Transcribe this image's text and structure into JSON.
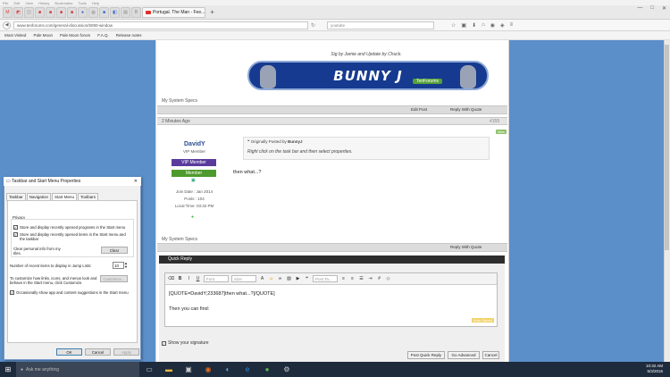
{
  "browser": {
    "menu": [
      "File",
      "Edit",
      "View",
      "History",
      "Bookmarks",
      "Tools",
      "Help"
    ],
    "active_tab_title": "Portugal. The Man - Fee...",
    "new_tab": "+",
    "url": "www.tenforums.com/general-discussion/5090-window",
    "search_placeholder": "youtube",
    "bookmarks": [
      "Most Visited",
      "Pale Moon",
      "Pale Moon forum",
      "F.A.Q.",
      "Release notes"
    ]
  },
  "post_top": {
    "sig_line": "Sig by Jamie and Update by Chuck.",
    "banner_text": "BUNNY J",
    "banner_ribbon": "TenForums",
    "my_system_specs": "My System Specs",
    "edit_post": "Edit Post",
    "reply_with_quote": "Reply With Quote"
  },
  "post": {
    "timestamp": "2 Minutes Ago",
    "post_number": "#155",
    "badge_new": "New",
    "username": "DavidY",
    "user_title": "VIP Member",
    "rank1": "VIP Member",
    "rank2": "Member",
    "join_date": "Join Date : Jan 2014",
    "posts": "Posts : 104",
    "local_time": "Local Time: 03:32 PM",
    "quote_header": "Originally Posted by",
    "quote_author": "BunnyJ",
    "quote_text": "Right click on the task bar and then select properties.",
    "body": "then what...?",
    "my_system_specs": "My System Specs",
    "reply_with_quote": "Reply With Quote"
  },
  "quick_reply": {
    "header": "Quick Reply",
    "font_placeholder": "Font",
    "size_placeholder": "Size",
    "post_tag_placeholder": "Post Ta...",
    "line1": "[QUOTE=DavidY;233687]then what...?[/QUOTE]",
    "line2": "Then you can find:",
    "autosave": "Auto Saved",
    "show_signature": "Show your signature",
    "post_quick_reply": "Post Quick Reply",
    "go_advanced": "Go Advanced",
    "cancel": "Cancel"
  },
  "dialog": {
    "title": "Taskbar and Start Menu Properties",
    "tabs": [
      "Taskbar",
      "Navigation",
      "Start Menu",
      "Toolbars"
    ],
    "privacy": "Privacy",
    "opt1": "Store and display recently opened programs in the Start menu",
    "opt2": "Store and display recently opened items in the Start menu and the taskbar",
    "clear_label": "Clear personal info from my tiles.",
    "clear_btn": "Clear",
    "jumplist_label": "Number of recent items to display in Jump Lists:",
    "jumplist_value": "10",
    "customize_label": "To customize how links, icons, and menus look and behave in the Start menu, click Customize.",
    "customize_btn": "Customize...",
    "opt3": "Occasionally show app and content suggestions in the Start menu",
    "ok": "OK",
    "cancel": "Cancel",
    "apply": "Apply"
  },
  "taskbar": {
    "search_placeholder": "Ask me anything",
    "time": "10:32 AM",
    "date": "5/3/2015"
  }
}
